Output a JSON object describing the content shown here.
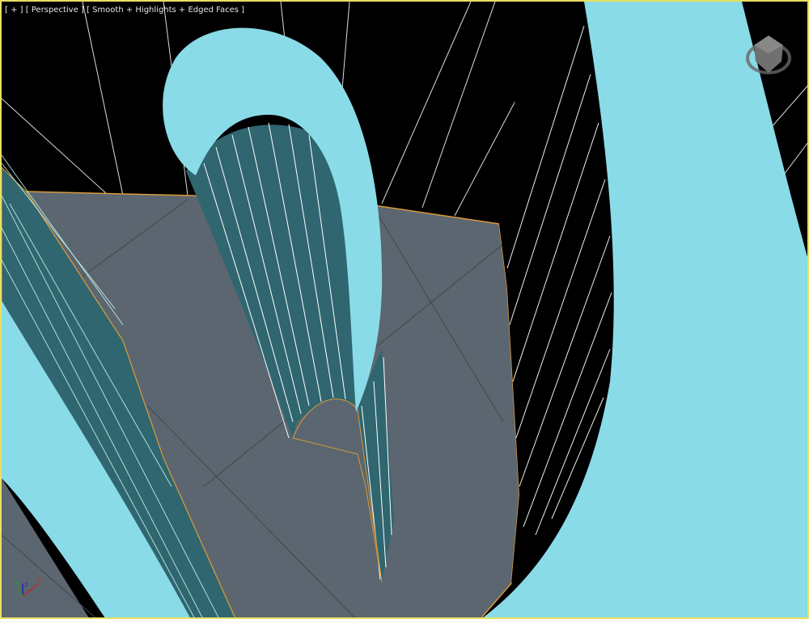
{
  "viewport": {
    "menu_label": "[ + ]",
    "view_label": "[ Perspective ]",
    "shading_label": "[ Smooth + Highlights + Edged Faces ]",
    "border_color": "#e8e060"
  },
  "gizmo": {
    "z_label": "z",
    "x_label": "x"
  },
  "colors": {
    "cyan": "#8adbe8",
    "gray": "#5b6670",
    "teal": "#2f6670",
    "edge": "#d99a3a"
  }
}
